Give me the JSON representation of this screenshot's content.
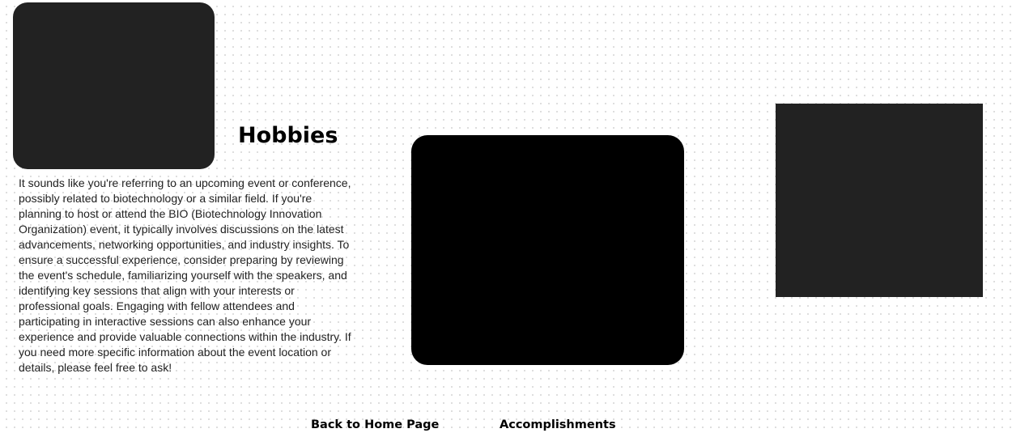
{
  "page": {
    "title": "Hobbies",
    "description": "It sounds like you're referring to an upcoming event or conference, possibly related to biotechnology or a similar field. If you're planning to host or attend the BIO (Biotechnology Innovation Organization) event, it typically involves discussions on the latest advancements, networking opportunities, and industry insights. To ensure a successful experience, consider preparing by reviewing the event's schedule, familiarizing yourself with the speakers, and identifying key sessions that align with your interests or professional goals. Engaging with fellow attendees and participating in interactive sessions can also enhance your experience and provide valuable connections within the industry. If you need more specific information about the event location or details, please feel free to ask!"
  },
  "images": {
    "left_color": "#222222",
    "center_color": "#000000",
    "right_color": "#222222"
  },
  "nav": {
    "home_label": "Back to Home Page",
    "accomplishments_label": "Accomplishments"
  }
}
